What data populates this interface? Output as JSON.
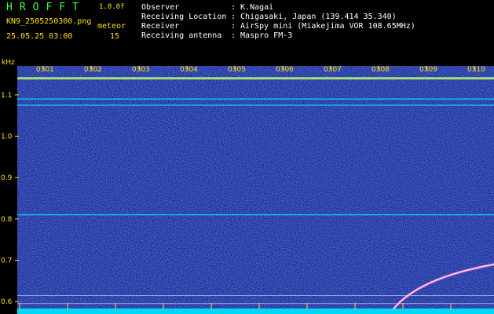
{
  "header": {
    "logo": "HROFFT",
    "version": "1.0.0f",
    "filename": "KN9_2505250300.png",
    "datetime": "25.05.25 03:00",
    "meteor_label": "meteor",
    "meteor_count": "15",
    "info": [
      {
        "key": "Observer",
        "value": ": K.Nagai"
      },
      {
        "key": "Receiving Location",
        "value": ": Chigasaki, Japan (139.414 35.340)"
      },
      {
        "key": "Receiver",
        "value": ": AirSpy mini (Miakejima VOR 108.65MHz)"
      },
      {
        "key": "Receiving antenna",
        "value": ": Maspro FM-3"
      }
    ]
  },
  "chart_data": {
    "type": "heatmap",
    "ylabel": "kHz",
    "y_ticks": [
      "1.1",
      "1.0",
      "0.9",
      "0.8",
      "0.7",
      "0.6"
    ],
    "x_ticks": [
      "0301",
      "0302",
      "0303",
      "0304",
      "0305",
      "0306",
      "0307",
      "0308",
      "0309",
      "0310"
    ],
    "ylim": [
      0.57,
      1.17
    ],
    "horizontal_lines_khz": [
      1.14,
      1.09,
      1.075,
      0.81
    ],
    "meteor_trail": {
      "start_minute": "0308",
      "end_minute": "0310",
      "start_khz": 0.58,
      "end_khz": 0.69
    },
    "colors": {
      "background": "#1a2a8c",
      "accent": "#ffe100",
      "signal": "#00e5ff"
    }
  }
}
